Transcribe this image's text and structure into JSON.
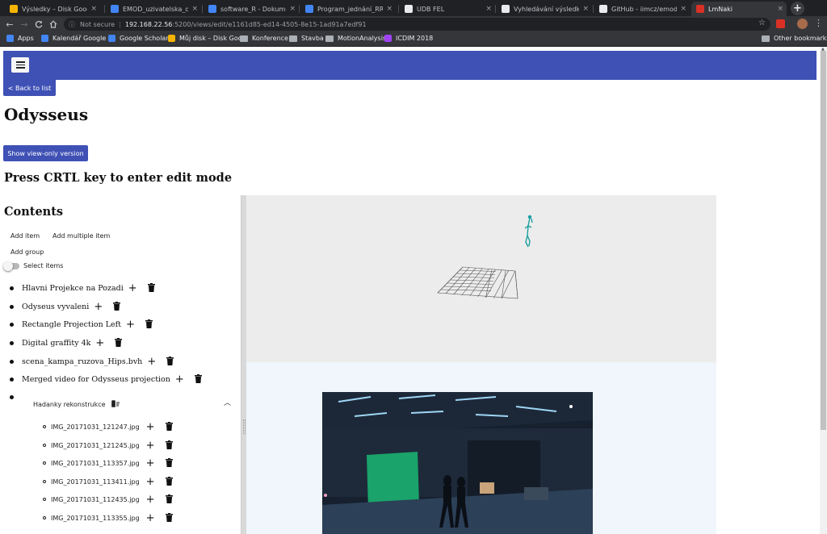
{
  "browser": {
    "tabs": [
      {
        "title": "Výsledky – Disk Google",
        "fav": "#f4b400",
        "active": false
      },
      {
        "title": "EMOD_uzivatelska_doku",
        "fav": "#4285f4",
        "active": false
      },
      {
        "title": "software_R - Dokumenty",
        "fav": "#4285f4",
        "active": false
      },
      {
        "title": "Program_jednání_RRIIM",
        "fav": "#4285f4",
        "active": false
      },
      {
        "title": "UDB FEL",
        "fav": "#e8eaed",
        "active": false
      },
      {
        "title": "Vyhledávání výsledků - V",
        "fav": "#e8eaed",
        "active": false
      },
      {
        "title": "GitHub - iimcz/emod",
        "fav": "#e8eaed",
        "active": false
      },
      {
        "title": "LmNaki",
        "fav": "#d93025",
        "active": true
      }
    ],
    "close_glyph": "×",
    "new_tab_glyph": "+",
    "nav": {
      "back": "←",
      "forward": "→",
      "reload": "C",
      "home": "⌂"
    },
    "omnibox": {
      "security": "Not secure",
      "host": "192.168.22.56",
      "path": ":5200/views/edit/e1161d85-ed14-4505-8e15-1ad91a7edf91"
    },
    "bookmarks": [
      {
        "label": "Apps",
        "color": "#4285f4"
      },
      {
        "label": "Kalendář Google -",
        "color": "#4285f4"
      },
      {
        "label": "Google Scholar",
        "color": "#4285f4"
      },
      {
        "label": "Můj disk – Disk Goo",
        "color": "#f4b400"
      },
      {
        "label": "Konference",
        "color": null
      },
      {
        "label": "Stavba",
        "color": null
      },
      {
        "label": "MotionAnalysis",
        "color": null
      },
      {
        "label": "ICDIM 2018",
        "color": "#a142f4"
      }
    ],
    "other_bookmarks": "Other bookmarks"
  },
  "app": {
    "accent": "#3f51b5",
    "back_label": "< Back to list",
    "title": "Odysseus",
    "view_only_label": "Show view-only version",
    "edit_hint": "Press CRTL key to enter edit mode",
    "contents_heading": "Contents",
    "add_item": "Add item",
    "add_multiple": "Add multiple item",
    "add_group": "Add group",
    "select_items": "Select items",
    "items": [
      "Hlavni Projekce na Pozadi",
      "Odyseus vyvaleni",
      "Rectangle Projection Left",
      "Digital graffity 4k",
      "scena_kampa_ruzova_Hips.bvh",
      "Merged video for Odysseus projection"
    ],
    "group": {
      "name": "Hadanky rekonstrukce",
      "children": [
        "IMG_20171031_121247.jpg",
        "IMG_20171031_121245.jpg",
        "IMG_20171031_113357.jpg",
        "IMG_20171031_113411.jpg",
        "IMG_20171031_112435.jpg",
        "IMG_20171031_113355.jpg"
      ]
    }
  }
}
